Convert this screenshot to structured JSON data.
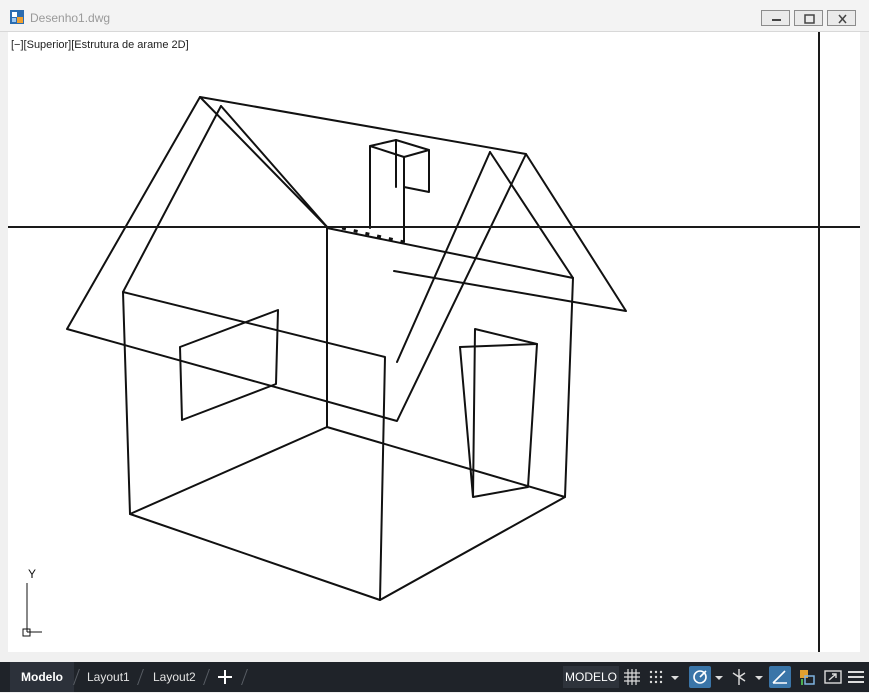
{
  "window": {
    "title": "Desenho1.dwg"
  },
  "viewport": {
    "label_minus": "[−]",
    "label_view": "[Superior]",
    "label_style": "[Estrutura de arame 2D]",
    "ucs_y": "Y"
  },
  "tabs": [
    {
      "label": "Modelo",
      "active": true
    },
    {
      "label": "Layout1",
      "active": false
    },
    {
      "label": "Layout2",
      "active": false
    }
  ],
  "statusbar": {
    "model_label": "MODELO"
  },
  "colors": {
    "status_bg": "#1f2329",
    "highlight": "#3a75a8",
    "drawing": "#111111"
  }
}
